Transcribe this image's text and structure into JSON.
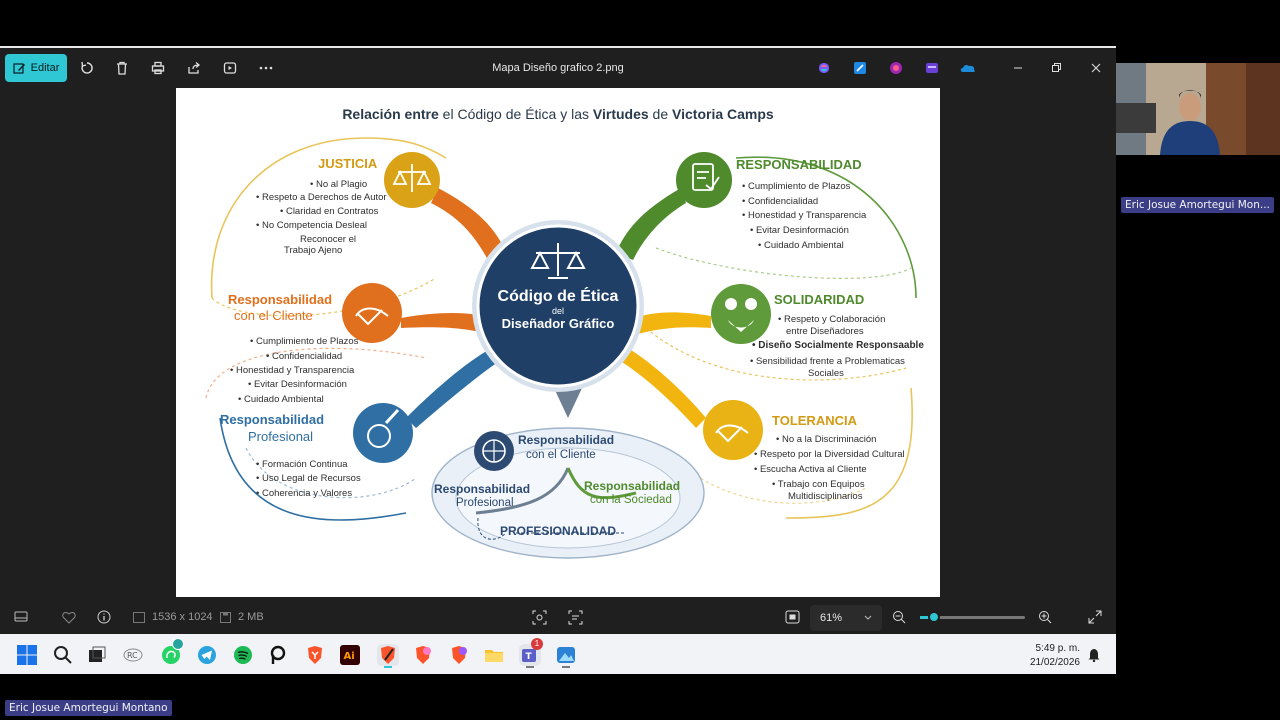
{
  "window": {
    "title": "Mapa Diseño grafico 2.png",
    "edit_label": "Editar"
  },
  "toolbar_icons": [
    "rotate-icon",
    "delete-icon",
    "print-icon",
    "share-icon",
    "slideshow-icon",
    "more-icon"
  ],
  "statusbar": {
    "dimensions": "1536 x 1024",
    "file_size": "2 MB",
    "zoom": "61%"
  },
  "mindmap": {
    "title_parts": [
      "Relación entre",
      " el Código de Ética y las ",
      "Virtudes",
      " de ",
      "Victoria Camps"
    ],
    "center": {
      "line1": "Código de Ética",
      "line2": "del",
      "line3": "Diseñador Gráfico"
    },
    "justicia": {
      "heading": "JUSTICIA",
      "items": [
        "• No al Plagio",
        "• Respeto a Derechos de Autor",
        "• Claridad en Contratos",
        "• No Competencia Desleal",
        "Reconocer el",
        "Trabajo Ajeno"
      ]
    },
    "resp_cliente": {
      "heading1": "Responsabilidad",
      "heading2": "con el Cliente",
      "items": [
        "• Cumplimiento de Plazos",
        "• Confidencialidad",
        "• Honestidad y Transparencia",
        "• Evitar Desinformación",
        "• Cuidado Ambiental"
      ]
    },
    "resp_profesional": {
      "heading1": "Responsabilidad",
      "heading2": "Profesional",
      "items": [
        "• Formación Continua",
        "• Uso Legal de Recursos",
        "• Coherencia y Valores"
      ]
    },
    "responsabilidad": {
      "heading": "RESPONSABILIDAD",
      "items": [
        "• Cumplimiento de Plazos",
        "• Confidencialidad",
        "• Honestidad y Transparencia",
        "• Evitar Desinformación",
        "• Cuidado Ambiental"
      ]
    },
    "solidaridad": {
      "heading": "SOLIDARIDAD",
      "items": [
        "• Respeto y Colaboración",
        "entre Diseñadores",
        "• Diseño Socialmente Responsaable",
        "• Sensibilidad frente a Problematicas",
        "Sociales"
      ]
    },
    "tolerancia": {
      "heading": "TOLERANCIA",
      "items": [
        "• No a la Discriminación",
        "• Respeto por la Diversidad Cultural",
        "• Escucha Activa al Cliente",
        "• Trabajo con Equipos",
        "Multidisciplinarios"
      ]
    },
    "bottom": {
      "cliente1": "Responsabilidad",
      "cliente2": "con el Cliente",
      "prof1": "Responsabilidad",
      "prof2": "Profesional",
      "soc1": "Responsabilidad",
      "soc2": "con la Sociedad",
      "profesionalidad": "PROFESIONALIDAD"
    }
  },
  "taskbar": {
    "time": "5:49 p. m.",
    "date": "21/02/2026",
    "whatsapp_badge": "",
    "teams_badge": "1"
  },
  "participants": {
    "cam_name": "Eric Josue Amortegui  Mon...",
    "self_name": "Eric Josue Amortegui  Montano"
  },
  "colors": {
    "accent": "#2fc7d4",
    "orange": "#e0701d",
    "gold": "#d39a13",
    "green": "#4f8a2d",
    "blue": "#2f6fa3",
    "navy": "#1f3f66"
  }
}
